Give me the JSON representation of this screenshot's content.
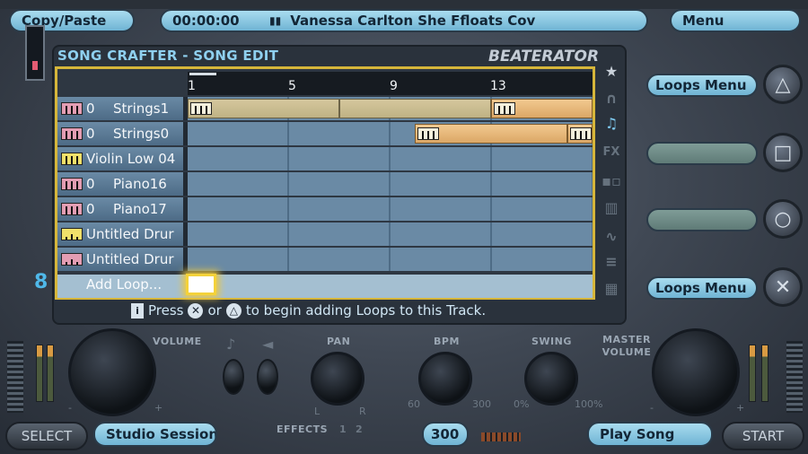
{
  "top_bar": {
    "copy_paste": "Copy/Paste",
    "time": "00:00:00",
    "song_title": "Vanessa Carlton She Ffloats Cov",
    "menu": "Menu"
  },
  "panel": {
    "title": "SONG CRAFTER - SONG EDIT",
    "brand": "BEATERATOR",
    "playhead_progress": 0.07
  },
  "ruler": {
    "ticks": [
      "1",
      "5",
      "9",
      "13"
    ]
  },
  "tracks": [
    {
      "icon": "keyboard-icon",
      "num": "0",
      "name": "Strings1"
    },
    {
      "icon": "keyboard-icon",
      "num": "0",
      "name": "Strings0"
    },
    {
      "icon": "keyboard-icon",
      "num": "",
      "name": "Violin Low 04"
    },
    {
      "icon": "keyboard-icon",
      "num": "0",
      "name": "Piano16"
    },
    {
      "icon": "keyboard-icon",
      "num": "0",
      "name": "Piano17"
    },
    {
      "icon": "drum-icon",
      "num": "",
      "name": "Untitled Drur"
    },
    {
      "icon": "drum-icon",
      "num": "",
      "name": "Untitled Drur"
    }
  ],
  "add_loop": "Add Loop...",
  "hint": {
    "press": "Press",
    "or": "or",
    "rest": "to begin adding Loops to this Track."
  },
  "right": {
    "loops_menu_top": "Loops Menu",
    "loops_menu_bottom": "Loops Menu"
  },
  "bottom": {
    "volume": "VOLUME",
    "pan": "PAN",
    "pan_l": "L",
    "pan_r": "R",
    "bpm": "BPM",
    "bpm_min": "60",
    "bpm_max": "300",
    "swing": "SWING",
    "swing_min": "0%",
    "swing_max": "100%",
    "master_volume": "MASTER VOLUME",
    "effects": "EFFECTS",
    "effects_1": "1",
    "effects_2": "2",
    "track_number": "8",
    "bpm_value": "300",
    "studio_session": "Studio Session",
    "play_song": "Play Song",
    "select": "SELECT",
    "start": "START",
    "minus": "-",
    "plus": "+"
  },
  "colors": {
    "accent": "#7ec9ef",
    "grid_border": "#d6b63a",
    "loop_tan": "#d5c79d",
    "loop_orange": "#f2c98f"
  }
}
